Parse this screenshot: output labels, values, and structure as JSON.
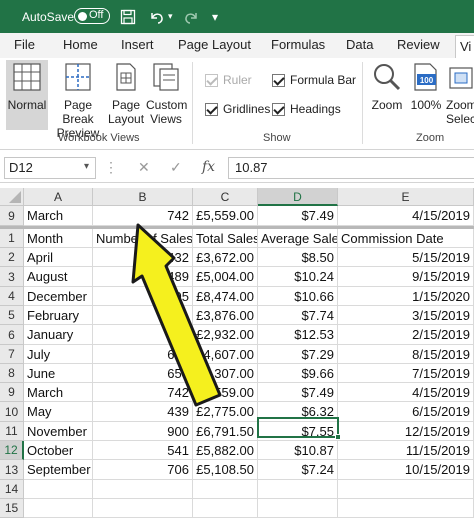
{
  "titlebar": {
    "autosave_label": "AutoSave",
    "autosave_state": "Off",
    "bg": "#217346"
  },
  "tabs": [
    "File",
    "Home",
    "Insert",
    "Page Layout",
    "Formulas",
    "Data",
    "Review",
    "Vi"
  ],
  "ribbon": {
    "workbook_views": {
      "normal": "Normal",
      "page_break_1": "Page Break",
      "page_break_2": "Preview",
      "page_layout_1": "Page",
      "page_layout_2": "Layout",
      "custom_1": "Custom",
      "custom_2": "Views",
      "label": "Workbook Views"
    },
    "show": {
      "ruler": "Ruler",
      "formula_bar": "Formula Bar",
      "gridlines": "Gridlines",
      "headings": "Headings",
      "label": "Show"
    },
    "zoom": {
      "zoom": "Zoom",
      "hundred": "100%",
      "zoom_sel_1": "Zoom",
      "zoom_sel_2": "Select",
      "label": "Zoom",
      "icon_text": "100"
    }
  },
  "formula_bar": {
    "name_box": "D12",
    "value": "10.87"
  },
  "columns": [
    "A",
    "B",
    "C",
    "D",
    "E"
  ],
  "frozen_row": {
    "num": "9",
    "cells": [
      "March",
      "742",
      "£5,559.00",
      "$7.49",
      "4/15/2019"
    ]
  },
  "header_row": {
    "num": "1",
    "cells": [
      "Month",
      "Number of Sales",
      "Total Sales",
      "Average Sale",
      "Commission Date"
    ]
  },
  "rows": [
    {
      "num": "2",
      "cells": [
        "April",
        "432",
        "£3,672.00",
        "$8.50",
        "5/15/2019"
      ]
    },
    {
      "num": "3",
      "cells": [
        "August",
        "489",
        "£5,004.00",
        "$10.24",
        "9/15/2019"
      ]
    },
    {
      "num": "4",
      "cells": [
        "December",
        "795",
        "£8,474.00",
        "$10.66",
        "1/15/2020"
      ]
    },
    {
      "num": "5",
      "cells": [
        "February",
        "501",
        "£3,876.00",
        "$7.74",
        "3/15/2019"
      ]
    },
    {
      "num": "6",
      "cells": [
        "January",
        "234",
        "£2,932.00",
        "$12.53",
        "2/15/2019"
      ]
    },
    {
      "num": "7",
      "cells": [
        "July",
        "632",
        "£4,607.00",
        "$7.29",
        "8/15/2019"
      ]
    },
    {
      "num": "8",
      "cells": [
        "June",
        "653",
        "£6,307.00",
        "$9.66",
        "7/15/2019"
      ]
    },
    {
      "num": "9",
      "cells": [
        "March",
        "742",
        "£5,559.00",
        "$7.49",
        "4/15/2019"
      ]
    },
    {
      "num": "10",
      "cells": [
        "May",
        "439",
        "£2,775.00",
        "$6.32",
        "6/15/2019"
      ]
    },
    {
      "num": "11",
      "cells": [
        "November",
        "900",
        "£6,791.50",
        "$7.55",
        "12/15/2019"
      ]
    },
    {
      "num": "12",
      "cells": [
        "October",
        "541",
        "£5,882.00",
        "$10.87",
        "11/15/2019"
      ]
    },
    {
      "num": "13",
      "cells": [
        "September",
        "706",
        "£5,108.50",
        "$7.24",
        "10/15/2019"
      ]
    },
    {
      "num": "14",
      "cells": [
        "",
        "",
        "",
        "",
        ""
      ]
    },
    {
      "num": "15",
      "cells": [
        "",
        "",
        "",
        "",
        ""
      ]
    }
  ],
  "colors": {
    "excel_green": "#217346",
    "arrow_fill": "#f5f01e",
    "arrow_stroke": "#1a1a1a"
  }
}
